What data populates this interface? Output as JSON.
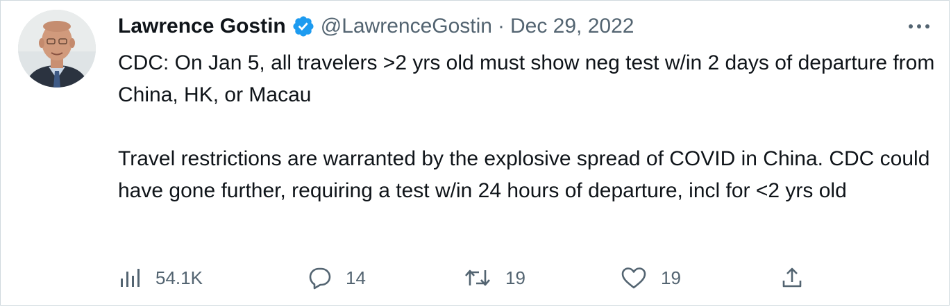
{
  "tweet": {
    "author_name": "Lawrence Gostin",
    "handle": "@LawrenceGostin",
    "separator": "·",
    "date": "Dec 29, 2022",
    "paragraph_1": "CDC: On Jan 5, all travelers >2 yrs old must show neg test w/in 2 days of departure from China, HK, or Macau",
    "paragraph_2": "Travel restrictions are warranted by the explosive spread of COVID in China. CDC could have gone further, requiring a test w/in 24 hours of departure, incl for <2 yrs old"
  },
  "actions": {
    "views": {
      "icon": "analytics-icon",
      "count": "54.1K"
    },
    "replies": {
      "icon": "reply-icon",
      "count": "14"
    },
    "retweets": {
      "icon": "retweet-icon",
      "count": "19"
    },
    "likes": {
      "icon": "heart-icon",
      "count": "19"
    },
    "share": {
      "icon": "share-icon"
    }
  },
  "colors": {
    "text_primary": "#0f1419",
    "text_secondary": "#536471",
    "verified_blue": "#1d9bf0",
    "border": "#cfd9de"
  }
}
